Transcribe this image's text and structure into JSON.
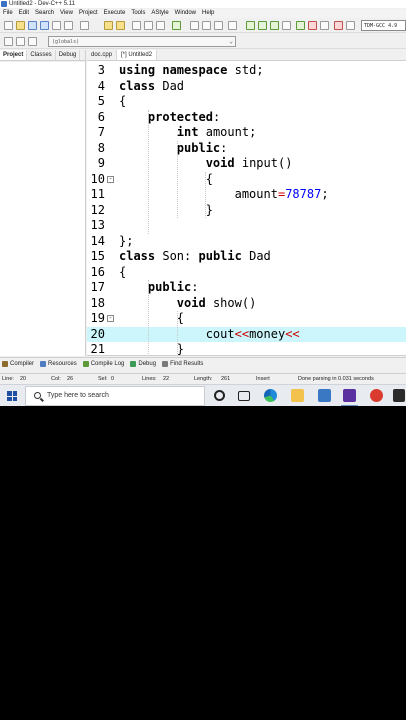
{
  "window": {
    "title": "Untitled2 - Dev-C++ 5.11"
  },
  "menu": [
    "File",
    "Edit",
    "Search",
    "View",
    "Project",
    "Execute",
    "Tools",
    "AStyle",
    "Window",
    "Help"
  ],
  "toolbar": {
    "compiler": "TDM-GCC 4.9",
    "scope": "(globals)"
  },
  "side_tabs": [
    "Project",
    "Classes",
    "Debug"
  ],
  "editor_tabs": [
    "doc.cpp",
    "[*] Untitled2"
  ],
  "code_lines": [
    {
      "n": "3",
      "text": "using namespace std;"
    },
    {
      "n": "4",
      "text": "class Dad"
    },
    {
      "n": "5",
      "text": "{"
    },
    {
      "n": "6",
      "text": "    protected:"
    },
    {
      "n": "7",
      "text": "        int amount;"
    },
    {
      "n": "8",
      "text": "        public:"
    },
    {
      "n": "9",
      "text": "            void input()"
    },
    {
      "n": "10",
      "text": "            {"
    },
    {
      "n": "11",
      "text": "                amount=78787;"
    },
    {
      "n": "12",
      "text": "            }"
    },
    {
      "n": "13",
      "text": ""
    },
    {
      "n": "14",
      "text": "};"
    },
    {
      "n": "15",
      "text": "class Son: public Dad"
    },
    {
      "n": "16",
      "text": "{"
    },
    {
      "n": "17",
      "text": "    public:"
    },
    {
      "n": "18",
      "text": "        void show()"
    },
    {
      "n": "19",
      "text": "        {"
    },
    {
      "n": "20",
      "text": "            cout<<money<<"
    },
    {
      "n": "21",
      "text": "        }"
    }
  ],
  "bottom_tabs": [
    "Compiler",
    "Resources",
    "Compile Log",
    "Debug",
    "Find Results"
  ],
  "status": {
    "line_label": "Line:",
    "line_value": "20",
    "col_label": "Col:",
    "col_value": "26",
    "sel_label": "Sel:",
    "sel_value": "0",
    "lines_label": "Lines:",
    "lines_value": "22",
    "length_label": "Length:",
    "length_value": "261",
    "mode": "Insert",
    "message": "Done parsing in 0.031 seconds"
  },
  "taskbar": {
    "search_placeholder": "Type here to search"
  }
}
